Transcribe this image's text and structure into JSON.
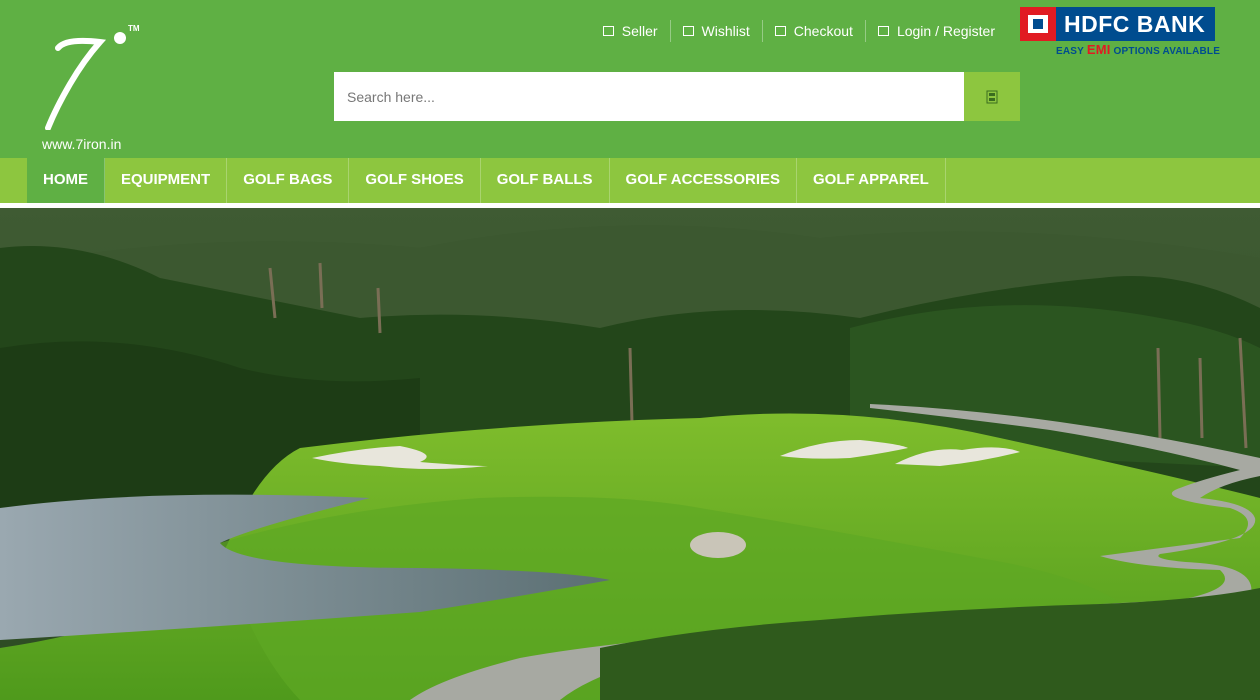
{
  "logo": {
    "mark": "7",
    "trademark": "TM",
    "url": "www.7iron.in"
  },
  "toplinks": [
    {
      "label": "Seller",
      "icon": "checkbox-icon"
    },
    {
      "label": "Wishlist",
      "icon": "checkbox-icon"
    },
    {
      "label": "Checkout",
      "icon": "checkbox-icon"
    },
    {
      "label": "Login / Register",
      "icon": "checkbox-icon"
    }
  ],
  "bank": {
    "name": "HDFC BANK",
    "tagline_pre": "EASY ",
    "tagline_emi": "EMI",
    "tagline_post": " OPTIONS AVAILABLE"
  },
  "search": {
    "placeholder": "Search here...",
    "value": "",
    "button_icon": "search-icon"
  },
  "nav": {
    "items": [
      {
        "label": "HOME",
        "active": true
      },
      {
        "label": "EQUIPMENT",
        "active": false
      },
      {
        "label": "GOLF BAGS",
        "active": false
      },
      {
        "label": "GOLF SHOES",
        "active": false
      },
      {
        "label": "GOLF BALLS",
        "active": false
      },
      {
        "label": "GOLF ACCESSORIES",
        "active": false
      },
      {
        "label": "GOLF APPAREL",
        "active": false
      }
    ]
  },
  "colors": {
    "header_bg": "#5fb044",
    "nav_bg": "#8dc63f",
    "nav_active": "#5fb044",
    "bank_blue": "#004c8f",
    "bank_red": "#e11b22"
  }
}
